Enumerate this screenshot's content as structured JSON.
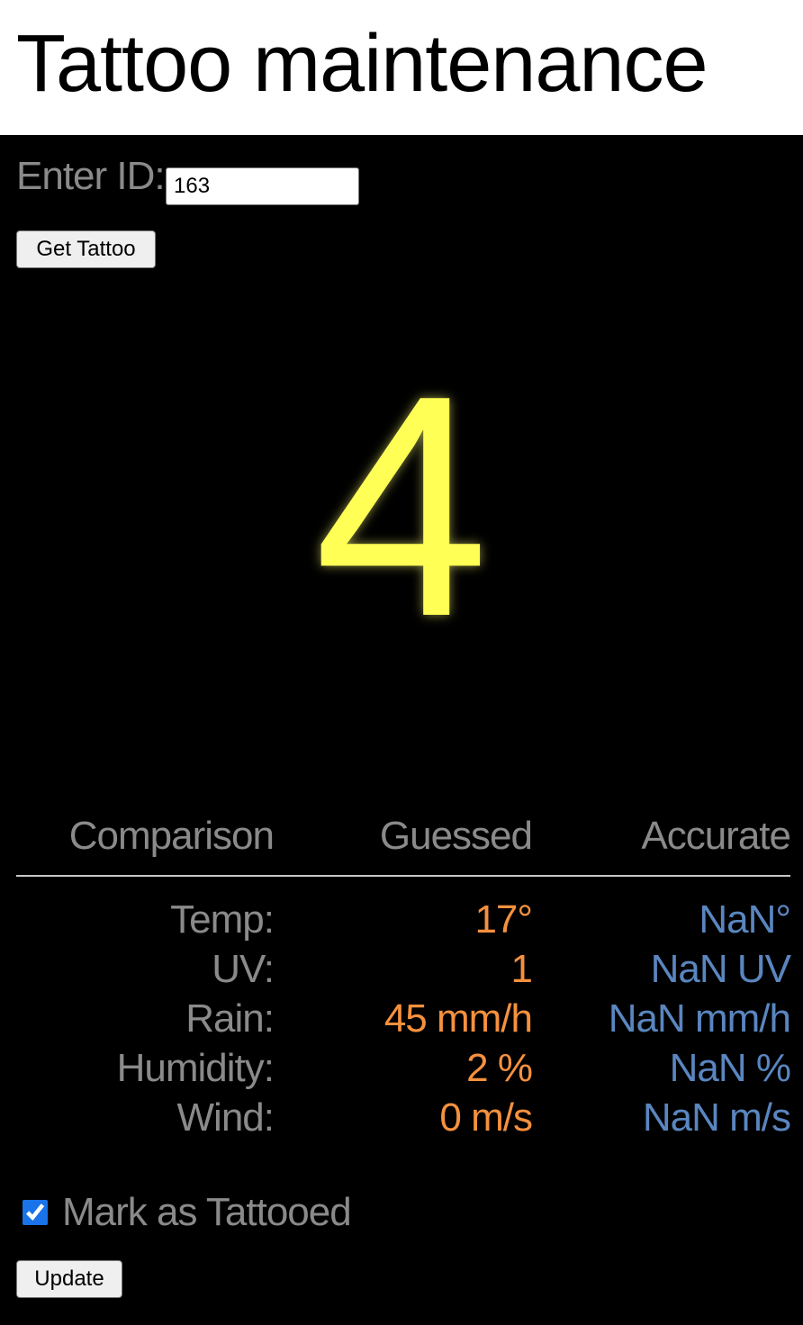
{
  "header": {
    "title": "Tattoo maintenance"
  },
  "lookup": {
    "label": "Enter ID:",
    "id_value": "163",
    "button_label": "Get Tattoo"
  },
  "score": {
    "value": "4",
    "color": "#ffff55"
  },
  "comparison": {
    "headers": [
      "Comparison",
      "Guessed",
      "Accurate"
    ],
    "rows": [
      {
        "label": "Temp:",
        "guessed": "17°",
        "accurate": "NaN°"
      },
      {
        "label": "UV:",
        "guessed": "1",
        "accurate": "NaN UV"
      },
      {
        "label": "Rain:",
        "guessed": "45 mm/h",
        "accurate": "NaN mm/h"
      },
      {
        "label": "Humidity:",
        "guessed": "2 %",
        "accurate": "NaN %"
      },
      {
        "label": "Wind:",
        "guessed": "0 m/s",
        "accurate": "NaN m/s"
      }
    ],
    "colors": {
      "guessed": "#f5913e",
      "accurate": "#5a86c0",
      "label": "#8a8a8a"
    }
  },
  "status": {
    "tattooed_label": "Mark as Tattooed",
    "tattooed_checked": true,
    "update_label": "Update"
  }
}
